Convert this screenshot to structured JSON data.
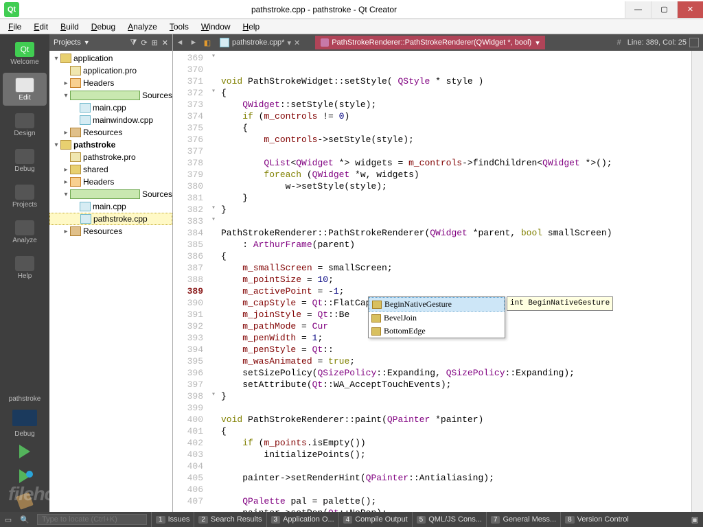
{
  "window": {
    "title": "pathstroke.cpp - pathstroke - Qt Creator"
  },
  "menus": [
    "File",
    "Edit",
    "Build",
    "Debug",
    "Analyze",
    "Tools",
    "Window",
    "Help"
  ],
  "leftrail": {
    "items": [
      {
        "id": "welcome",
        "label": "Welcome"
      },
      {
        "id": "edit",
        "label": "Edit",
        "selected": true
      },
      {
        "id": "design",
        "label": "Design"
      },
      {
        "id": "debug",
        "label": "Debug"
      },
      {
        "id": "projects",
        "label": "Projects"
      },
      {
        "id": "analyze",
        "label": "Analyze"
      },
      {
        "id": "help",
        "label": "Help"
      }
    ],
    "kit_project": "pathstroke",
    "kit_config": "Debug"
  },
  "sidebar": {
    "title": "Projects",
    "tree": [
      {
        "d": 0,
        "tw": "▾",
        "ic": "proj",
        "label": "application"
      },
      {
        "d": 1,
        "tw": "",
        "ic": "pro",
        "label": "application.pro"
      },
      {
        "d": 1,
        "tw": "▸",
        "ic": "hdr",
        "label": "Headers"
      },
      {
        "d": 1,
        "tw": "▾",
        "ic": "src",
        "label": "Sources"
      },
      {
        "d": 2,
        "tw": "",
        "ic": "cpp",
        "label": "main.cpp"
      },
      {
        "d": 2,
        "tw": "",
        "ic": "cpp",
        "label": "mainwindow.cpp"
      },
      {
        "d": 1,
        "tw": "▸",
        "ic": "res",
        "label": "Resources"
      },
      {
        "d": 0,
        "tw": "▾",
        "ic": "proj",
        "label": "pathstroke",
        "bold": true
      },
      {
        "d": 1,
        "tw": "",
        "ic": "pro",
        "label": "pathstroke.pro"
      },
      {
        "d": 1,
        "tw": "▸",
        "ic": "proj",
        "label": "shared"
      },
      {
        "d": 1,
        "tw": "▸",
        "ic": "hdr",
        "label": "Headers"
      },
      {
        "d": 1,
        "tw": "▾",
        "ic": "src",
        "label": "Sources"
      },
      {
        "d": 2,
        "tw": "",
        "ic": "cpp",
        "label": "main.cpp"
      },
      {
        "d": 2,
        "tw": "",
        "ic": "cpp",
        "label": "pathstroke.cpp",
        "sel": true
      },
      {
        "d": 1,
        "tw": "▸",
        "ic": "res",
        "label": "Resources"
      }
    ]
  },
  "filetabs": {
    "file": "pathstroke.cpp*",
    "symbol": "PathStrokeRenderer::PathStrokeRenderer(QWidget *, bool)",
    "linecol": "Line: 389, Col: 25"
  },
  "code": {
    "start": 369,
    "current": 389,
    "lines": [
      {
        "n": 369,
        "fold": "▾",
        "segs": [
          [
            "kw",
            "void"
          ],
          [
            "nm",
            " PathStrokeWidget::setStyle( "
          ],
          [
            "ty",
            "QStyle"
          ],
          [
            "nm",
            " * style )"
          ]
        ]
      },
      {
        "n": 370,
        "segs": [
          [
            "nm",
            "{"
          ]
        ]
      },
      {
        "n": 371,
        "segs": [
          [
            "nm",
            "    "
          ],
          [
            "ty",
            "QWidget"
          ],
          [
            "nm",
            "::setStyle(style);"
          ]
        ]
      },
      {
        "n": 372,
        "fold": "▾",
        "segs": [
          [
            "nm",
            "    "
          ],
          [
            "kw",
            "if"
          ],
          [
            "nm",
            " ("
          ],
          [
            "mv",
            "m_controls"
          ],
          [
            "nm",
            " != "
          ],
          [
            "num",
            "0"
          ],
          [
            "nm",
            ")"
          ]
        ]
      },
      {
        "n": 373,
        "segs": [
          [
            "nm",
            "    {"
          ]
        ]
      },
      {
        "n": 374,
        "segs": [
          [
            "nm",
            "        "
          ],
          [
            "mv",
            "m_controls"
          ],
          [
            "nm",
            "->setStyle(style);"
          ]
        ]
      },
      {
        "n": 375,
        "segs": [
          [
            "nm",
            ""
          ]
        ]
      },
      {
        "n": 376,
        "segs": [
          [
            "nm",
            "        "
          ],
          [
            "ty",
            "QList"
          ],
          [
            "nm",
            "<"
          ],
          [
            "ty",
            "QWidget"
          ],
          [
            "nm",
            " *> widgets = "
          ],
          [
            "mv",
            "m_controls"
          ],
          [
            "nm",
            "->findChildren<"
          ],
          [
            "ty",
            "QWidget"
          ],
          [
            "nm",
            " *>();"
          ]
        ]
      },
      {
        "n": 377,
        "segs": [
          [
            "nm",
            "        "
          ],
          [
            "kw",
            "foreach"
          ],
          [
            "nm",
            " ("
          ],
          [
            "ty",
            "QWidget"
          ],
          [
            "nm",
            " *w, widgets)"
          ]
        ]
      },
      {
        "n": 378,
        "segs": [
          [
            "nm",
            "            w->setStyle(style);"
          ]
        ]
      },
      {
        "n": 379,
        "segs": [
          [
            "nm",
            "    }"
          ]
        ]
      },
      {
        "n": 380,
        "segs": [
          [
            "nm",
            "}"
          ]
        ]
      },
      {
        "n": 381,
        "segs": [
          [
            "nm",
            ""
          ]
        ]
      },
      {
        "n": 382,
        "fold": "▾",
        "segs": [
          [
            "nm",
            "PathStrokeRenderer::PathStrokeRenderer("
          ],
          [
            "ty",
            "QWidget"
          ],
          [
            "nm",
            " *parent, "
          ],
          [
            "kw",
            "bool"
          ],
          [
            "nm",
            " smallScreen)"
          ]
        ]
      },
      {
        "n": 383,
        "fold": "▾",
        "segs": [
          [
            "nm",
            "    : "
          ],
          [
            "ty",
            "ArthurFrame"
          ],
          [
            "nm",
            "(parent)"
          ]
        ]
      },
      {
        "n": 384,
        "segs": [
          [
            "nm",
            "{"
          ]
        ]
      },
      {
        "n": 385,
        "segs": [
          [
            "nm",
            "    "
          ],
          [
            "mv",
            "m_smallScreen"
          ],
          [
            "nm",
            " = smallScreen;"
          ]
        ]
      },
      {
        "n": 386,
        "segs": [
          [
            "nm",
            "    "
          ],
          [
            "mv",
            "m_pointSize"
          ],
          [
            "nm",
            " = "
          ],
          [
            "num",
            "10"
          ],
          [
            "nm",
            ";"
          ]
        ]
      },
      {
        "n": 387,
        "segs": [
          [
            "nm",
            "    "
          ],
          [
            "mv",
            "m_activePoint"
          ],
          [
            "nm",
            " = -"
          ],
          [
            "num",
            "1"
          ],
          [
            "nm",
            ";"
          ]
        ]
      },
      {
        "n": 388,
        "segs": [
          [
            "nm",
            "    "
          ],
          [
            "mv",
            "m_capStyle"
          ],
          [
            "nm",
            " = "
          ],
          [
            "ty",
            "Qt"
          ],
          [
            "nm",
            "::FlatCap;"
          ]
        ]
      },
      {
        "n": 389,
        "segs": [
          [
            "nm",
            "    "
          ],
          [
            "mv",
            "m_joinStyle"
          ],
          [
            "nm",
            " = "
          ],
          [
            "ty",
            "Qt"
          ],
          [
            "nm",
            "::Be"
          ]
        ]
      },
      {
        "n": 390,
        "segs": [
          [
            "nm",
            "    "
          ],
          [
            "mv",
            "m_pathMode"
          ],
          [
            "nm",
            " = "
          ],
          [
            "ty",
            "Cur"
          ]
        ]
      },
      {
        "n": 391,
        "segs": [
          [
            "nm",
            "    "
          ],
          [
            "mv",
            "m_penWidth"
          ],
          [
            "nm",
            " = "
          ],
          [
            "num",
            "1"
          ],
          [
            "nm",
            ";"
          ]
        ]
      },
      {
        "n": 392,
        "segs": [
          [
            "nm",
            "    "
          ],
          [
            "mv",
            "m_penStyle"
          ],
          [
            "nm",
            " = "
          ],
          [
            "ty",
            "Qt"
          ],
          [
            "nm",
            "::"
          ]
        ]
      },
      {
        "n": 393,
        "segs": [
          [
            "nm",
            "    "
          ],
          [
            "mv",
            "m_wasAnimated"
          ],
          [
            "nm",
            " = "
          ],
          [
            "kw",
            "true"
          ],
          [
            "nm",
            ";"
          ]
        ]
      },
      {
        "n": 394,
        "segs": [
          [
            "nm",
            "    setSizePolicy("
          ],
          [
            "ty",
            "QSizePolicy"
          ],
          [
            "nm",
            "::Expanding, "
          ],
          [
            "ty",
            "QSizePolicy"
          ],
          [
            "nm",
            "::Expanding);"
          ]
        ]
      },
      {
        "n": 395,
        "segs": [
          [
            "nm",
            "    setAttribute("
          ],
          [
            "ty",
            "Qt"
          ],
          [
            "nm",
            "::WA_AcceptTouchEvents);"
          ]
        ]
      },
      {
        "n": 396,
        "segs": [
          [
            "nm",
            "}"
          ]
        ]
      },
      {
        "n": 397,
        "segs": [
          [
            "nm",
            ""
          ]
        ]
      },
      {
        "n": 398,
        "fold": "▾",
        "segs": [
          [
            "kw",
            "void"
          ],
          [
            "nm",
            " PathStrokeRenderer::"
          ],
          [
            "nm",
            "paint"
          ],
          [
            "nm",
            "("
          ],
          [
            "ty",
            "QPainter"
          ],
          [
            "nm",
            " *painter)"
          ]
        ]
      },
      {
        "n": 399,
        "segs": [
          [
            "nm",
            "{"
          ]
        ]
      },
      {
        "n": 400,
        "segs": [
          [
            "nm",
            "    "
          ],
          [
            "kw",
            "if"
          ],
          [
            "nm",
            " ("
          ],
          [
            "mv",
            "m_points"
          ],
          [
            "nm",
            ".isEmpty())"
          ]
        ]
      },
      {
        "n": 401,
        "segs": [
          [
            "nm",
            "        initializePoints();"
          ]
        ]
      },
      {
        "n": 402,
        "segs": [
          [
            "nm",
            ""
          ]
        ]
      },
      {
        "n": 403,
        "segs": [
          [
            "nm",
            "    painter->setRenderHint("
          ],
          [
            "ty",
            "QPainter"
          ],
          [
            "nm",
            "::Antialiasing);"
          ]
        ]
      },
      {
        "n": 404,
        "segs": [
          [
            "nm",
            ""
          ]
        ]
      },
      {
        "n": 405,
        "segs": [
          [
            "nm",
            "    "
          ],
          [
            "ty",
            "QPalette"
          ],
          [
            "nm",
            " pal = palette();"
          ]
        ]
      },
      {
        "n": 406,
        "segs": [
          [
            "nm",
            "    painter->setPen("
          ],
          [
            "ty",
            "Qt"
          ],
          [
            "nm",
            "::NoPen);"
          ]
        ]
      },
      {
        "n": 407,
        "segs": [
          [
            "nm",
            ""
          ]
        ]
      }
    ]
  },
  "autocomplete": {
    "items": [
      {
        "label": "BeginNativeGesture",
        "sel": true
      },
      {
        "label": "BevelJoin"
      },
      {
        "label": "BottomEdge"
      }
    ],
    "tooltip": "int BeginNativeGesture"
  },
  "statusbar": {
    "placeholder": "Type to locate (Ctrl+K)",
    "panels": [
      {
        "n": "1",
        "label": "Issues"
      },
      {
        "n": "2",
        "label": "Search Results"
      },
      {
        "n": "3",
        "label": "Application O..."
      },
      {
        "n": "4",
        "label": "Compile Output"
      },
      {
        "n": "5",
        "label": "QML/JS Cons..."
      },
      {
        "n": "7",
        "label": "General Mess..."
      },
      {
        "n": "8",
        "label": "Version Control"
      }
    ]
  },
  "watermark": "filehorse.com"
}
